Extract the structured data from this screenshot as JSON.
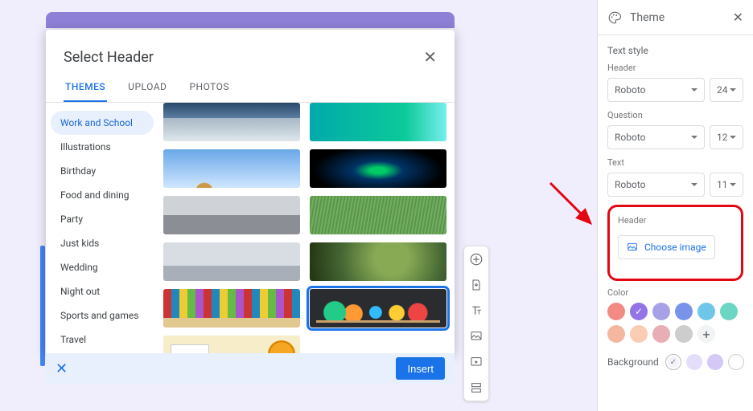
{
  "theme": {
    "title": "Theme",
    "text_style_label": "Text style",
    "header_label": "Header",
    "question_label": "Question",
    "text_label": "Text",
    "header_font": "Roboto",
    "header_size": "24",
    "question_font": "Roboto",
    "question_size": "12",
    "text_font": "Roboto",
    "text_size": "11",
    "header_image_label": "Header",
    "choose_image_label": "Choose image",
    "color_label": "Color",
    "background_label": "Background",
    "swatches": [
      "#f28b82",
      "#9374e6",
      "#a7a2e8",
      "#7a93ea",
      "#6fc6e8",
      "#6bd6c4",
      "#f5b79e",
      "#f9ccb4",
      "#e8aeb6",
      "#cdcdcd"
    ],
    "bg_swatches": [
      "#f4f1fc",
      "#e5defb",
      "#d4c9f6",
      "#ffffff"
    ]
  },
  "modal": {
    "title": "Select Header",
    "tabs": [
      "THEMES",
      "UPLOAD",
      "PHOTOS"
    ],
    "active_tab": 0,
    "categories": [
      "Work and School",
      "Illustrations",
      "Birthday",
      "Food and dining",
      "Party",
      "Just kids",
      "Wedding",
      "Night out",
      "Sports and games",
      "Travel"
    ],
    "active_category": 0,
    "insert_label": "Insert",
    "selected_thumb_index": 9
  },
  "toolbar_icons": [
    "add",
    "import",
    "title",
    "image",
    "video",
    "section"
  ]
}
